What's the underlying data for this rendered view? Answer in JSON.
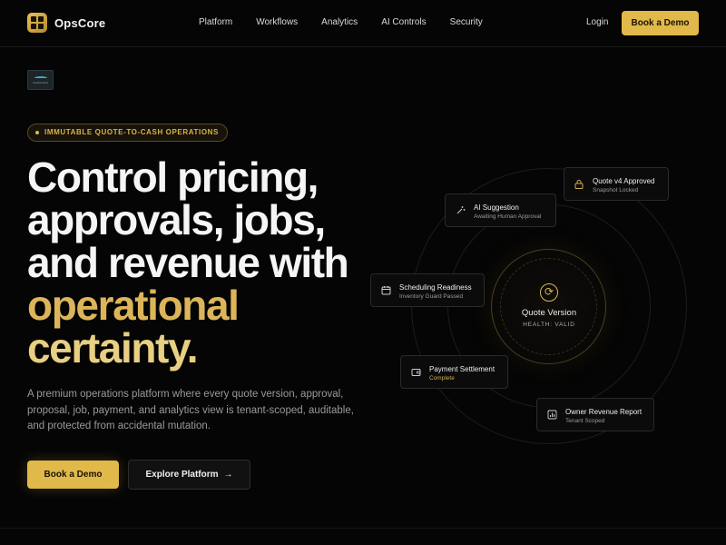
{
  "nav": {
    "brand": "OpsCore",
    "links": [
      "Platform",
      "Workflows",
      "Analytics",
      "AI Controls",
      "Security"
    ],
    "login": "Login",
    "cta": "Book a Demo"
  },
  "badge_image": {
    "caption": "Quote Pilot"
  },
  "hero": {
    "pill": "IMMUTABLE QUOTE-TO-CASH OPERATIONS",
    "headline": [
      "Control pricing,",
      "approvals, jobs,",
      "and revenue with",
      "operational",
      "certainty."
    ],
    "description": "A premium operations platform where every quote version, approval, proposal, job, payment, and analytics view is tenant-scoped, auditable, and protected from accidental mutation.",
    "primary_cta": "Book a Demo",
    "secondary_cta": "Explore Platform",
    "secondary_arrow": "→"
  },
  "diagram": {
    "core": {
      "title": "Quote Version",
      "status": "HEALTH: VALID",
      "icon": "refresh-icon"
    },
    "cards": {
      "quote": {
        "title": "Quote v4 Approved",
        "sub": "Snapshot Locked",
        "icon": "lock-icon"
      },
      "ai": {
        "title": "AI Suggestion",
        "sub": "Awaiting Human Approval",
        "icon": "sparkle-icon"
      },
      "sched": {
        "title": "Scheduling Readiness",
        "sub": "Inventory Guard Passed",
        "icon": "calendar-icon"
      },
      "pay": {
        "title": "Payment Settlement",
        "sub": "Complete",
        "icon": "wallet-icon"
      },
      "owner": {
        "title": "Owner Revenue Report",
        "sub": "Tenant Scoped",
        "icon": "bar-chart-icon"
      }
    }
  },
  "colors": {
    "accent": "#e0b94a",
    "background": "#050505"
  }
}
